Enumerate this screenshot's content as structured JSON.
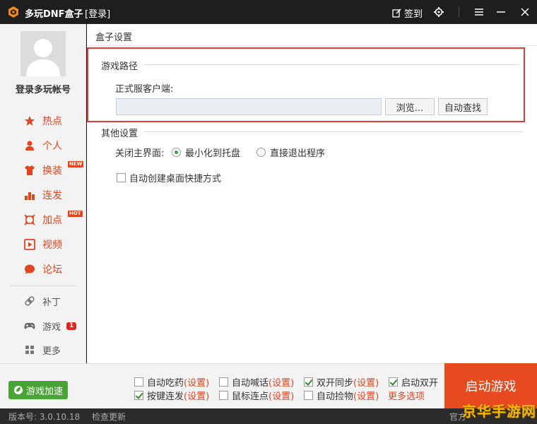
{
  "titlebar": {
    "app_title": "多玩DNF盒子",
    "login_label": "[登录]",
    "signin_label": "签到"
  },
  "sidebar": {
    "account_name": "登录多玩帐号",
    "nav": [
      {
        "label": "热点",
        "icon": "star-icon"
      },
      {
        "label": "个人",
        "icon": "user-icon"
      },
      {
        "label": "换装",
        "icon": "shirt-icon",
        "badge": "NEW"
      },
      {
        "label": "连发",
        "icon": "bars-icon"
      },
      {
        "label": "加点",
        "icon": "crosshair-icon",
        "badge": "HOT"
      },
      {
        "label": "视频",
        "icon": "play-icon"
      },
      {
        "label": "论坛",
        "icon": "chat-icon"
      }
    ],
    "tools": [
      {
        "label": "补丁",
        "icon": "patch-icon"
      },
      {
        "label": "游戏",
        "icon": "gamepad-icon",
        "badge": "1"
      },
      {
        "label": "更多",
        "icon": "grid-icon"
      }
    ]
  },
  "main": {
    "page_title": "盒子设置",
    "game_path": {
      "section_title": "游戏路径",
      "field_label": "正式服客户端:",
      "path_value": "",
      "browse_label": "浏览...",
      "auto_find_label": "自动查找"
    },
    "other": {
      "section_title": "其他设置",
      "close_label": "关闭主界面:",
      "radio_tray": "最小化到托盘",
      "radio_exit": "直接退出程序",
      "shortcut_label": "自动创建桌面快捷方式"
    }
  },
  "bottombar": {
    "accel_label": "游戏加速",
    "checks": [
      {
        "label": "自动吃药",
        "link": "(设置)",
        "checked": false
      },
      {
        "label": "自动喊话",
        "link": "(设置)",
        "checked": false
      },
      {
        "label": "双开同步",
        "link": "(设置)",
        "checked": true
      },
      {
        "label": "启动双开",
        "link": "",
        "checked": true
      },
      {
        "label": "按键连发",
        "link": "(设置)",
        "checked": true
      },
      {
        "label": "鼠标连点",
        "link": "(设置)",
        "checked": false
      },
      {
        "label": "自动捡物",
        "link": "(设置)",
        "checked": false
      }
    ],
    "more_options": "更多选项",
    "launch_label": "启动游戏"
  },
  "statusbar": {
    "version": "版本号: 3.0.10.18",
    "check_update": "检查更新",
    "right_text": "官方"
  },
  "watermark": "京华手游网",
  "colors": {
    "accent": "#e0451f",
    "launch": "#e64a1e",
    "accel": "#49a336",
    "highlight_box": "#e53935"
  }
}
